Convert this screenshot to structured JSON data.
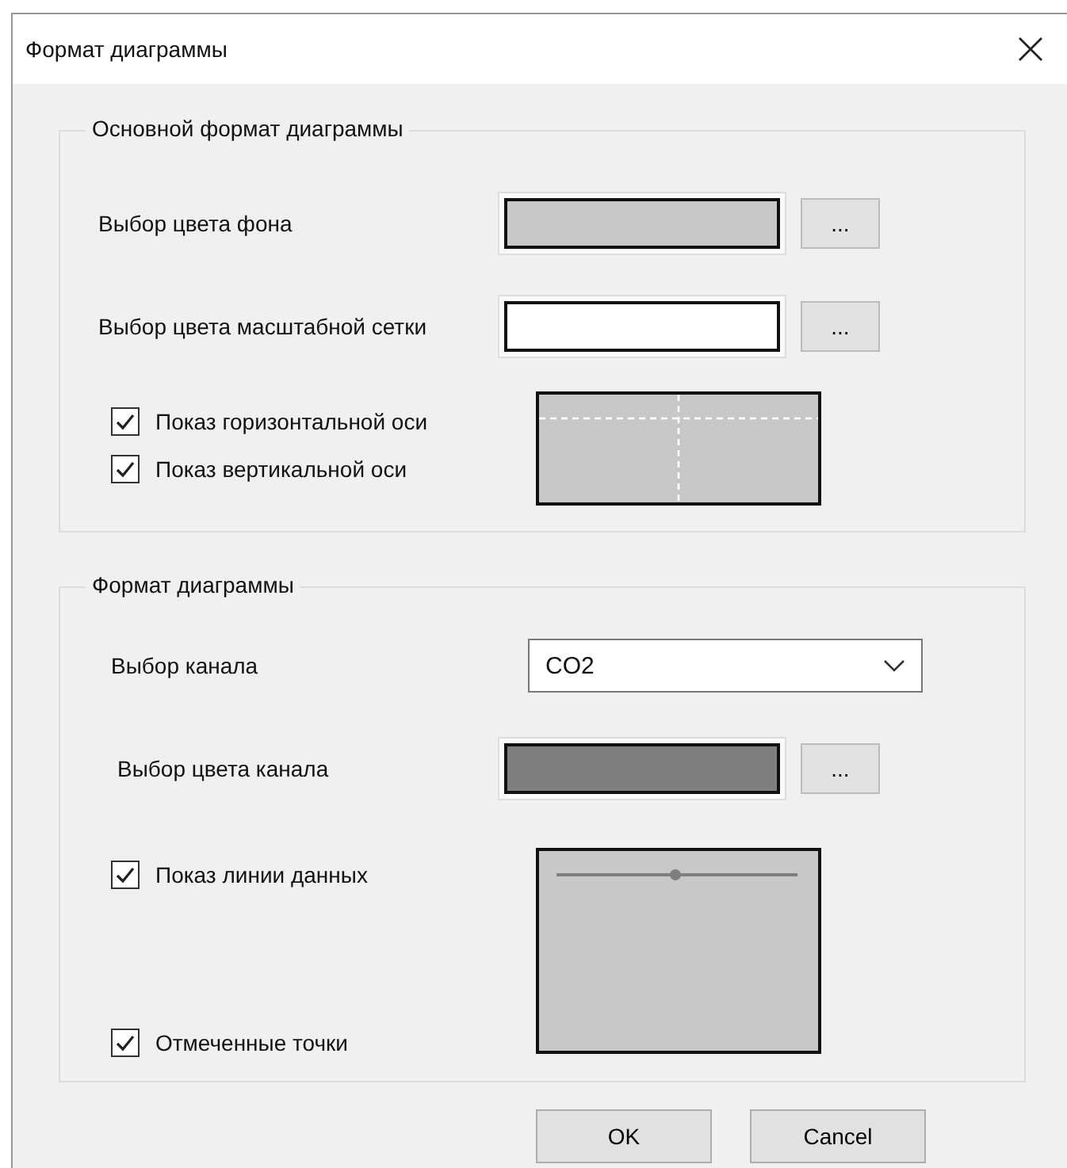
{
  "window": {
    "title": "Формат диаграммы"
  },
  "base_format": {
    "title": "Основной формат диаграммы",
    "background_color": {
      "label": "Выбор цвета фона",
      "color": "#c8c8c8",
      "button": "..."
    },
    "grid_color": {
      "label": "Выбор цвета масштабной сетки",
      "color": "#ffffff",
      "button": "..."
    },
    "show_horizontal_axis": {
      "label": "Показ горизонтальной оси",
      "checked": true
    },
    "show_vertical_axis": {
      "label": "Показ вертикальной оси",
      "checked": true
    }
  },
  "chart_format": {
    "title": "Формат диаграммы",
    "channel": {
      "label": "Выбор канала",
      "value": "CO2"
    },
    "channel_color": {
      "label": "Выбор цвета канала",
      "color": "#7f7f7f",
      "button": "..."
    },
    "show_data_line": {
      "label": "Показ линии данных",
      "checked": true
    },
    "marked_points": {
      "label": "Отмеченные точки",
      "checked": true
    }
  },
  "buttons": [
    "OK",
    "Cancel"
  ]
}
